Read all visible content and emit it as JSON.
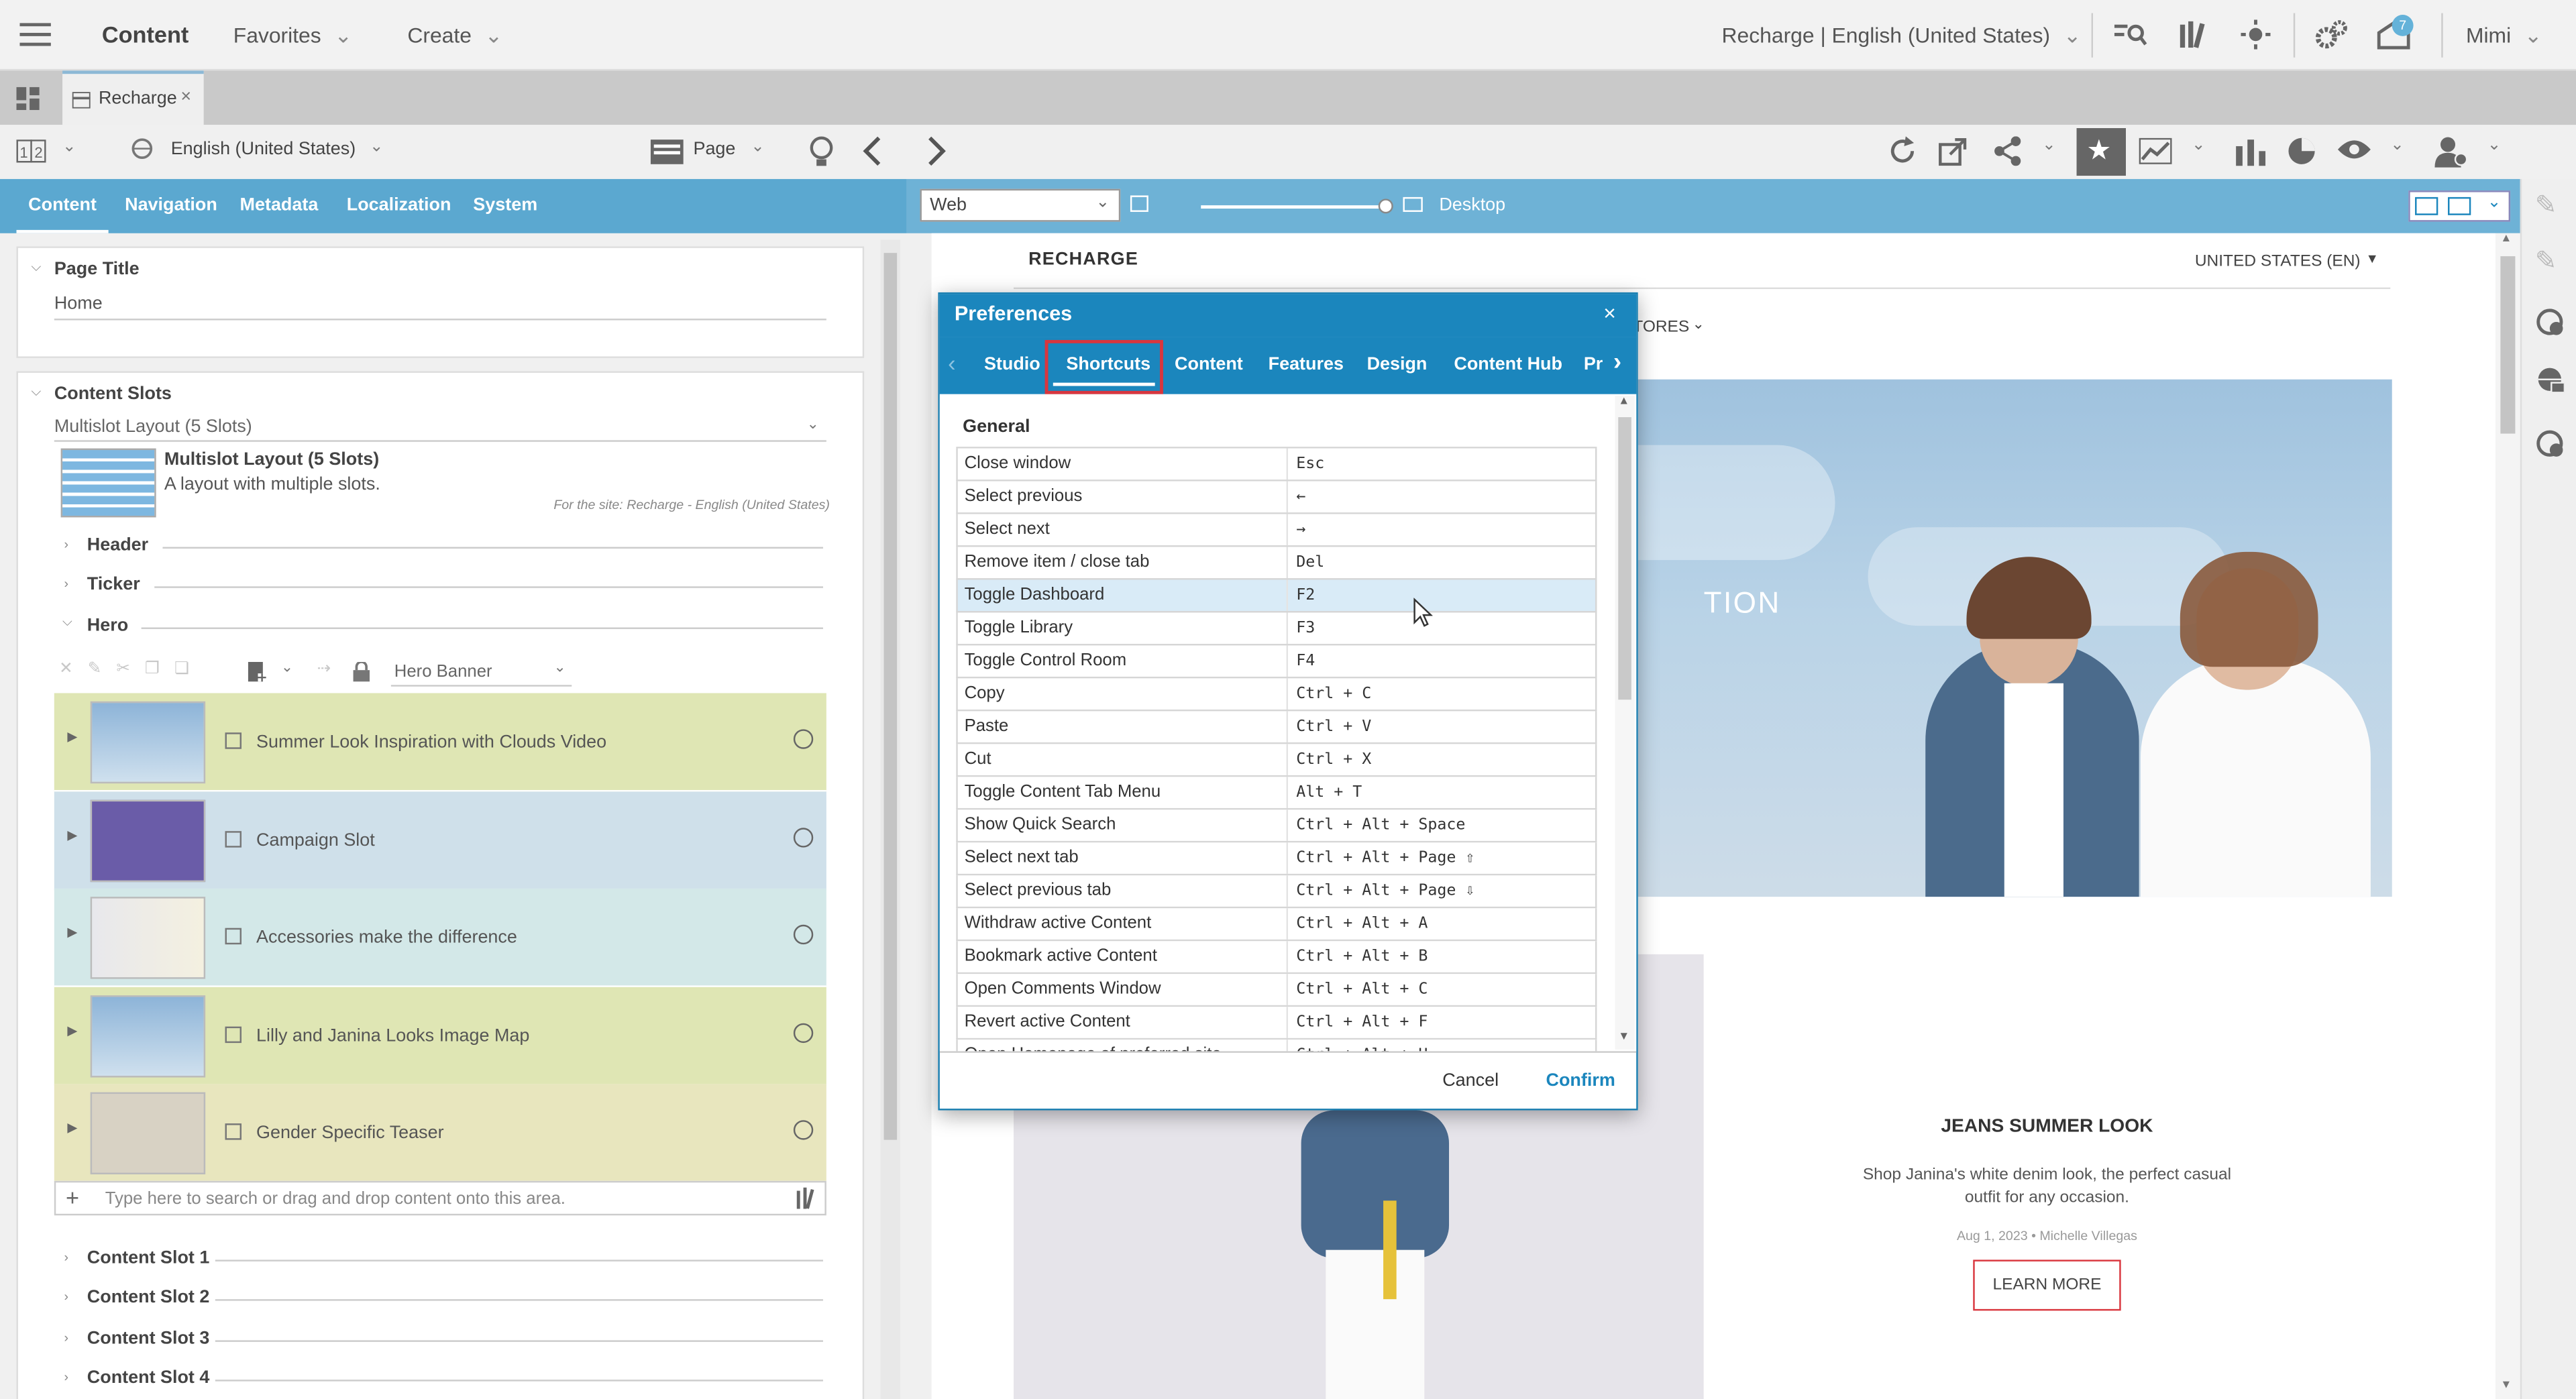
{
  "topbar": {
    "app_title": "Content",
    "favorites": "Favorites",
    "create": "Create",
    "site": "Recharge | English (United States)",
    "user": "Mimi",
    "notif_count": "7"
  },
  "doctab": {
    "label": "Recharge"
  },
  "sidebar": {
    "locale": "English (United States)",
    "page_dropdown": "Page",
    "tabs": [
      "Content",
      "Navigation",
      "Metadata",
      "Localization",
      "System"
    ],
    "page_title": {
      "label": "Page Title",
      "value": "Home"
    },
    "content_slots": {
      "label": "Content Slots",
      "layout_select": "Multislot Layout (5 Slots)",
      "layout_name": "Multislot Layout (5 Slots)",
      "layout_desc": "A layout with multiple slots.",
      "layout_site": "For the site: Recharge - English (United States)"
    },
    "sections": [
      "Header",
      "Ticker",
      "Hero"
    ],
    "hero_select": "Hero Banner",
    "hero_items": [
      {
        "label": "Summer Look Inspiration with Clouds Video",
        "color": "#dfe6b4"
      },
      {
        "label": "Campaign Slot",
        "color": "#cfe0ea"
      },
      {
        "label": "Accessories make the difference",
        "color": "#d3e8e8"
      },
      {
        "label": "Lilly and Janina Looks Image Map",
        "color": "#dfe6b4"
      },
      {
        "label": "Gender Specific Teaser",
        "color": "#e8e6be"
      }
    ],
    "drop_placeholder": "Type here to search or drag and drop content onto this area.",
    "more_slots": [
      "Content Slot 1",
      "Content Slot 2",
      "Content Slot 3",
      "Content Slot 4"
    ]
  },
  "preview": {
    "channel": "Web",
    "device": "Desktop",
    "brand": "RECHARGE",
    "country": "UNITED STATES (EN)",
    "nav_fragment": "TORES",
    "hero_fragment": "TION",
    "promo": {
      "title": "JEANS SUMMER LOOK",
      "text_line1": "Shop Janina's white denim look, the perfect casual",
      "text_line2": "outfit for any occasion.",
      "meta": "Aug 1, 2023 • Michelle Villegas",
      "cta": "LEARN MORE"
    }
  },
  "dialog": {
    "title": "Preferences",
    "tabs": [
      "Studio",
      "Shortcuts",
      "Content",
      "Features",
      "Design",
      "Content Hub",
      "Pr"
    ],
    "section": "General",
    "shortcuts": [
      {
        "action": "Close window",
        "keys": "Esc"
      },
      {
        "action": "Select previous",
        "keys": "←"
      },
      {
        "action": "Select next",
        "keys": "→"
      },
      {
        "action": "Remove item / close tab",
        "keys": "Del"
      },
      {
        "action": "Toggle Dashboard",
        "keys": "F2"
      },
      {
        "action": "Toggle Library",
        "keys": "F3"
      },
      {
        "action": "Toggle Control Room",
        "keys": "F4"
      },
      {
        "action": "Copy",
        "keys": "Ctrl + C"
      },
      {
        "action": "Paste",
        "keys": "Ctrl + V"
      },
      {
        "action": "Cut",
        "keys": "Ctrl + X"
      },
      {
        "action": "Toggle Content Tab Menu",
        "keys": "Alt + T"
      },
      {
        "action": "Show Quick Search",
        "keys": "Ctrl + Alt + Space"
      },
      {
        "action": "Select next tab",
        "keys": "Ctrl + Alt + Page ⇧"
      },
      {
        "action": "Select previous tab",
        "keys": "Ctrl + Alt + Page ⇩"
      },
      {
        "action": "Withdraw active Content",
        "keys": "Ctrl + Alt + A"
      },
      {
        "action": "Bookmark active Content",
        "keys": "Ctrl + Alt + B"
      },
      {
        "action": "Open Comments Window",
        "keys": "Ctrl + Alt + C"
      },
      {
        "action": "Revert active Content",
        "keys": "Ctrl + Alt + F"
      },
      {
        "action": "Open Homepage of preferred site",
        "keys": "Ctrl + Alt + H"
      }
    ],
    "cancel": "Cancel",
    "confirm": "Confirm"
  },
  "colors": {
    "accent": "#1b86bd",
    "subtab_bg": "#5ba8d0",
    "highlight_row": "#d9ebf7",
    "selected_tab_border": "#d9363e"
  }
}
